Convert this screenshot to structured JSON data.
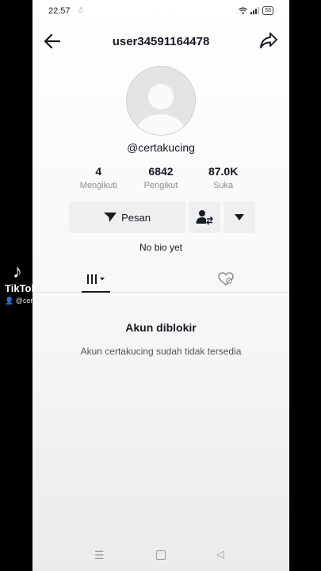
{
  "status_bar": {
    "time": "22.57",
    "battery": "58"
  },
  "header": {
    "username": "user34591164478"
  },
  "profile": {
    "handle": "@certakucing",
    "stats": [
      {
        "value": "4",
        "label": "Mengikuti"
      },
      {
        "value": "6842",
        "label": "Pengikut"
      },
      {
        "value": "87.0K",
        "label": "Suka"
      }
    ],
    "message_button": "Pesan",
    "bio": "No bio yet"
  },
  "blocked": {
    "title": "Akun diblokir",
    "description": "Akun certakucing sudah tidak tersedia"
  },
  "watermark": {
    "brand": "TikTok",
    "user": "@cer"
  }
}
